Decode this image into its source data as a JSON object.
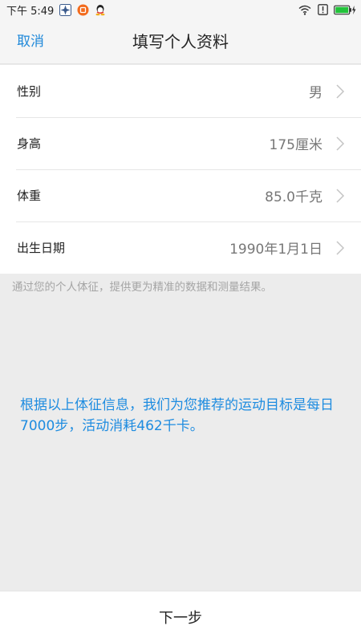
{
  "status_bar": {
    "time": "下午 5:49",
    "icons": [
      "fan-icon",
      "orange-app-icon",
      "qq-icon",
      "wifi-icon",
      "alert-icon",
      "battery-charging-icon"
    ]
  },
  "header": {
    "cancel_label": "取消",
    "title": "填写个人资料"
  },
  "fields": [
    {
      "label": "性别",
      "value": "男"
    },
    {
      "label": "身高",
      "value": "175厘米"
    },
    {
      "label": "体重",
      "value": "85.0千克"
    },
    {
      "label": "出生日期",
      "value": "1990年1月1日"
    }
  ],
  "note": "通过您的个人体征，提供更为精准的数据和测量结果。",
  "recommendation": "根据以上体征信息，我们为您推荐的运动目标是每日7000步，活动消耗462千卡。",
  "bottom": {
    "next_label": "下一步"
  },
  "colors": {
    "accent": "#1e88d9",
    "background": "#ececec",
    "battery": "#22c33a"
  }
}
